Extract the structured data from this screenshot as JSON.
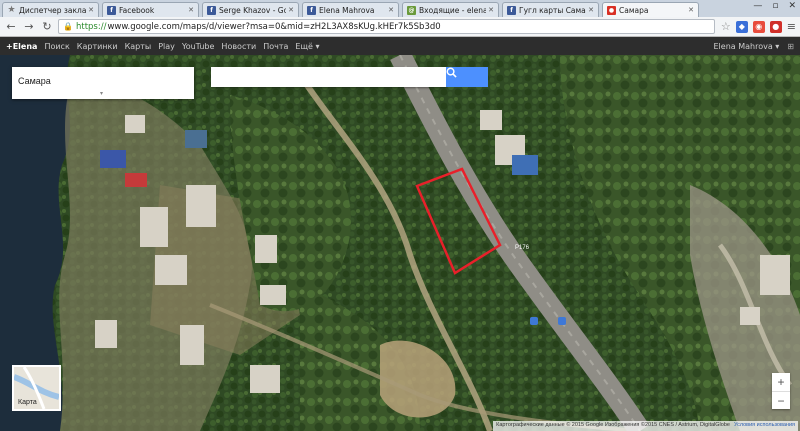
{
  "tabs": [
    {
      "title": "Диспетчер закладок",
      "icon": "star-icon",
      "color": "#888888"
    },
    {
      "title": "Facebook",
      "icon": "facebook-icon",
      "color": "#3b5998"
    },
    {
      "title": "Serge Khazov - Goo",
      "icon": "facebook-icon",
      "color": "#3b5998"
    },
    {
      "title": "Elena Mahrova",
      "icon": "facebook-icon",
      "color": "#3b5998"
    },
    {
      "title": "Входящие - elena_m",
      "icon": "mail-icon",
      "color": "#6a9a3a"
    },
    {
      "title": "Гугл карты Самара",
      "icon": "facebook-icon",
      "color": "#3b5998"
    },
    {
      "title": "Самара",
      "icon": "maps-pin-icon",
      "color": "#d93025"
    }
  ],
  "address": {
    "scheme": "https://",
    "url": "www.google.com/maps/d/viewer?msa=0&mid=zH2L3AX8sKUg.kHEr7k5Sb3d0"
  },
  "gbar": {
    "links": [
      "+Elena",
      "Поиск",
      "Картинки",
      "Карты",
      "Play",
      "YouTube",
      "Новости",
      "Почта",
      "Ещё ▾"
    ],
    "user": "Elena Mahrova ▾"
  },
  "map": {
    "title": "Самара",
    "search_placeholder": "",
    "layer_label": "Карта",
    "road_label": "Р176",
    "attribution": "Картографические данные © 2015 Google Изображения ©2015 CNES / Astrium, DigitalGlobe",
    "terms": "Условия использования",
    "zoom_in": "+",
    "zoom_out": "−",
    "highlight_color": "#e8202a"
  }
}
